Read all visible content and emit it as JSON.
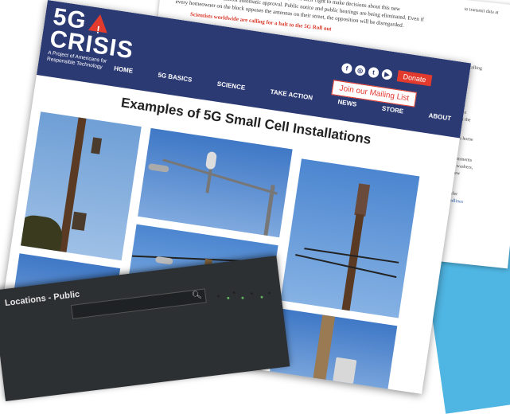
{
  "back_page": {
    "lines": [
      "are being stripped of their right to make decisions about this new",
      "meant almost automatic approval. Public notice and public hearings are being eliminated. Even if",
      "every homeowner on the block opposes the antennas on their street, the opposition will be disregarded."
    ],
    "red_line": "Scientists worldwide are calling for a halt to the 5G Roll out",
    "right_snippets": [
      "to transmit data at",
      "ation calling",
      "icates",
      "people",
      "d that the",
      "buy a home",
      "d comments",
      "low washers,",
      "nt new",
      "e safer",
      "Landlines"
    ]
  },
  "main_page": {
    "logo": {
      "line1": "5G",
      "line2": "CRISIS",
      "tagline": "A Project of Americans for Responsible Technology",
      "warn_glyph": "!"
    },
    "socials": [
      {
        "icon": "facebook-icon",
        "glyph": "f"
      },
      {
        "icon": "instagram-icon",
        "glyph": "◎"
      },
      {
        "icon": "twitter-icon",
        "glyph": "t"
      },
      {
        "icon": "youtube-icon",
        "glyph": "▶"
      }
    ],
    "donate_label": "Donate",
    "mailing_label": "Join our Mailing List",
    "nav": [
      "HOME",
      "5G BASICS",
      "SCIENCE",
      "TAKE ACTION",
      "NEWS",
      "STORE",
      "ABOUT"
    ],
    "title": "Examples of 5G Small Cell Installations"
  },
  "map_panel": {
    "title": "Locations - Public",
    "search_placeholder": "",
    "search_icon": "search-icon"
  },
  "colors": {
    "header": "#2c3a74",
    "accent": "#e23b2e",
    "sky": "#6f9fd6",
    "map_bg": "#2d3033"
  }
}
